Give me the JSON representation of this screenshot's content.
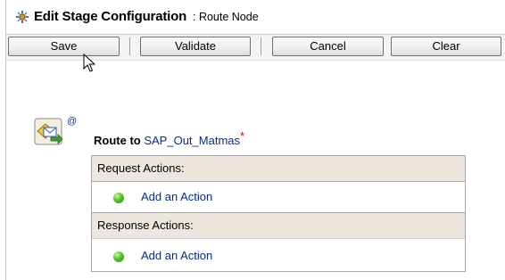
{
  "header": {
    "title": "Edit Stage Configuration",
    "subtitle": ": Route Node",
    "icon": "stage-config-icon"
  },
  "toolbar": {
    "buttons": [
      {
        "label": "Save"
      },
      {
        "label": "Validate"
      },
      {
        "label": "Cancel"
      },
      {
        "label": "Clear"
      }
    ]
  },
  "route": {
    "prefix": "Route to",
    "target": "SAP_Out_Matmas",
    "required_marker": "*",
    "at_marker": "@",
    "icon": "route-node-icon"
  },
  "sections": [
    {
      "heading": "Request Actions:",
      "link": "Add an Action"
    },
    {
      "heading": "Response Actions:",
      "link": "Add an Action"
    }
  ],
  "colors": {
    "section_header_bg": "#ece6df",
    "link": "#0a2a8a",
    "required": "#cc0000",
    "status_dot": "#56c22c"
  }
}
